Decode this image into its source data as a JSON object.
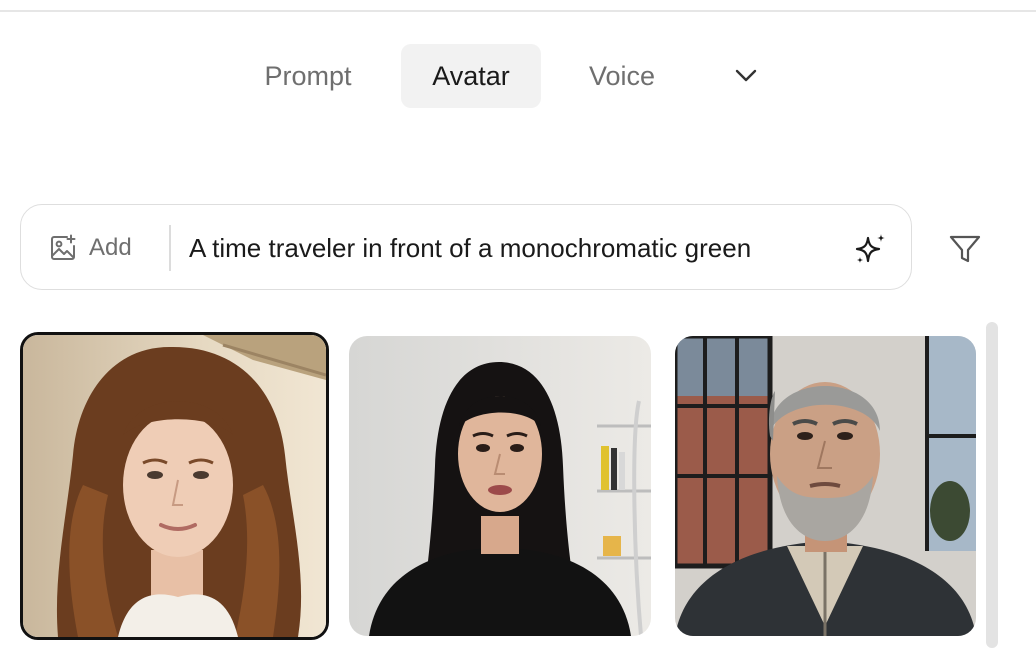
{
  "tabs": {
    "prompt": "Prompt",
    "avatar": "Avatar",
    "voice": "Voice",
    "active": "Avatar"
  },
  "search": {
    "add_label": "Add",
    "value": "A time traveler in front of a monochromatic green"
  },
  "icons": {
    "more": "chevron-down-icon",
    "add": "image-plus-icon",
    "generate": "sparkle-icon",
    "filter": "filter-icon"
  },
  "avatars": [
    {
      "selected": true
    },
    {
      "selected": false
    },
    {
      "selected": false
    }
  ],
  "colors": {
    "active_tab_bg": "#f2f2f2",
    "selected_border": "#111111"
  }
}
